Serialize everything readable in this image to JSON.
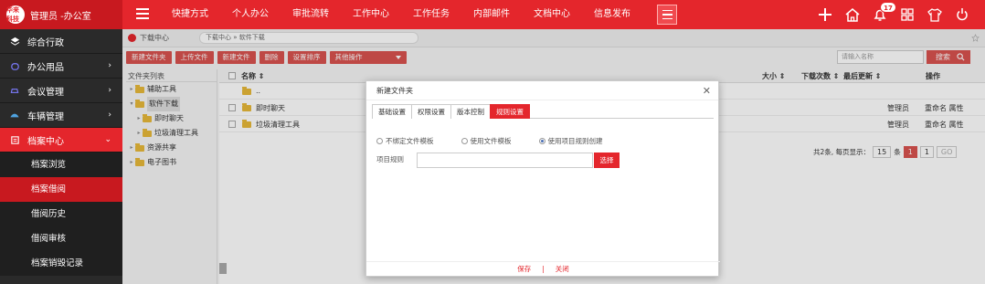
{
  "header": {
    "logo_text": "华来科技",
    "user_label": "管理员 -办公室",
    "nav": [
      "快捷方式",
      "个人办公",
      "审批流转",
      "工作中心",
      "工作任务",
      "内部邮件",
      "文档中心",
      "信息发布"
    ],
    "notification_count": "17",
    "accent_color": "#e4262c"
  },
  "sidebar": {
    "items": [
      {
        "label": "综合行政",
        "icon": "layers-icon",
        "has_arrow": false
      },
      {
        "label": "办公用品",
        "icon": "box-icon",
        "has_arrow": true
      },
      {
        "label": "会议管理",
        "icon": "car-icon",
        "has_arrow": true
      },
      {
        "label": "车辆管理",
        "icon": "vehicle-icon",
        "has_arrow": true
      },
      {
        "label": "档案中心",
        "icon": "archive-icon",
        "has_arrow": true,
        "expanded": true
      }
    ],
    "sub_items": [
      "档案浏览",
      "档案借阅",
      "借阅历史",
      "借阅审核",
      "档案销毁记录"
    ],
    "active_sub": "档案借阅"
  },
  "content": {
    "crumb_home": "下载中心",
    "crumb_path": "下载中心 » 软件下载",
    "toolbar": [
      "新建文件夹",
      "上传文件",
      "新建文件",
      "删除",
      "设置排序"
    ],
    "toolbar_select": "其他操作",
    "search_placeholder": "请输入名称",
    "search_button": "搜索",
    "tree_header": "文件夹列表",
    "tree": [
      {
        "label": "辅助工具",
        "level": 0,
        "has_caret": true
      },
      {
        "label": "软件下载",
        "level": 0,
        "has_caret": true,
        "selected": true
      },
      {
        "label": "即时聊天",
        "level": 1,
        "has_caret": true
      },
      {
        "label": "垃圾清理工具",
        "level": 1,
        "has_caret": true
      },
      {
        "label": "资源共享",
        "level": 0,
        "has_caret": true
      },
      {
        "label": "电子图书",
        "level": 0,
        "has_caret": true
      }
    ],
    "grid_headers": {
      "name": "名称 ⇕",
      "size": "大小 ⇕",
      "downloads": "下载次数 ⇕",
      "updated": "最后更新 ⇕",
      "ops": "操作"
    },
    "rows": [
      {
        "name": "..",
        "owner": "",
        "ops": "",
        "checkbox": false
      },
      {
        "name": "即时聊天",
        "owner": "管理员",
        "ops": "重命名 属性",
        "checkbox": true
      },
      {
        "name": "垃圾清理工具",
        "owner": "管理员",
        "ops": "重命名 属性",
        "checkbox": true
      }
    ],
    "pager": {
      "summary": "共2条, 每页显示：",
      "per_page": "15",
      "unit": "条",
      "current": "1",
      "page_input": "1",
      "go": "GO"
    }
  },
  "modal": {
    "title": "新建文件夹",
    "tabs": [
      "基础设置",
      "权限设置",
      "版本控制",
      "规则设置"
    ],
    "active_tab": "规则设置",
    "radios": [
      {
        "label": "不绑定文件模板",
        "checked": false
      },
      {
        "label": "使用文件模板",
        "checked": false
      },
      {
        "label": "使用项目规则创建",
        "checked": true
      }
    ],
    "rule_label": "项目规则",
    "rule_value": "",
    "select_button": "选择",
    "save": "保存",
    "separator": "|",
    "close": "关闭"
  }
}
